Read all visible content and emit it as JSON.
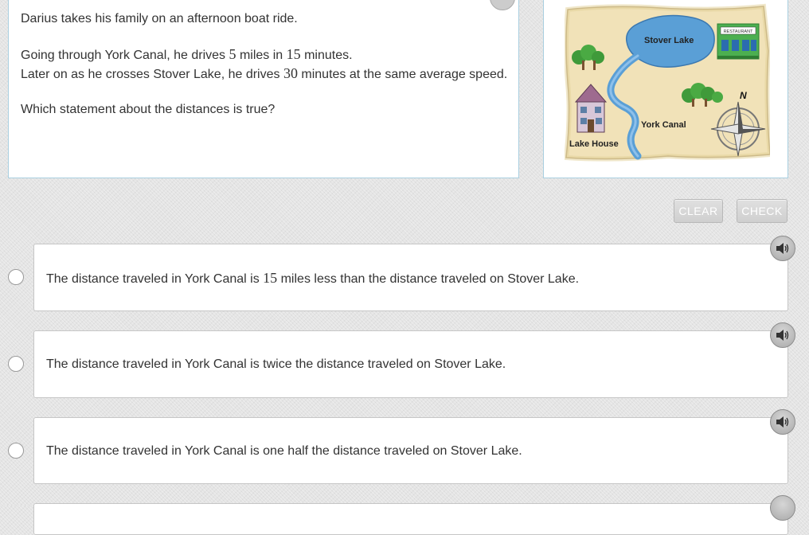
{
  "question": {
    "line1": "Darius takes his family on an afternoon boat ride.",
    "line2_a": "Going through York Canal, he drives ",
    "line2_num1": "5",
    "line2_b": " miles in ",
    "line2_num2": "15",
    "line2_c": " minutes.",
    "line3_a": "Later on as he crosses Stover Lake, he drives ",
    "line3_num": "30",
    "line3_b": " minutes at the same average speed.",
    "prompt": "Which statement about the distances is true?"
  },
  "map": {
    "stover_lake": "Stover Lake",
    "restaurant": "RESTAURANT",
    "york_canal": "York Canal",
    "lake_house": "Lake House",
    "north": "N"
  },
  "buttons": {
    "clear": "CLEAR",
    "check": "CHECK"
  },
  "options": [
    {
      "a": "The distance traveled in York Canal is ",
      "num": "15",
      "b": " miles less than the distance traveled on Stover Lake."
    },
    {
      "a": "The distance traveled in York Canal is twice the distance traveled on Stover Lake."
    },
    {
      "a": "The distance traveled in York Canal is one half the distance traveled on Stover Lake."
    }
  ],
  "icons": {
    "audio": "speaker-icon",
    "radio": "radio-button"
  },
  "colors": {
    "panel_border": "#a9cfe0",
    "button_bg": "#d6d6d6",
    "water": "#6fa8dc"
  }
}
